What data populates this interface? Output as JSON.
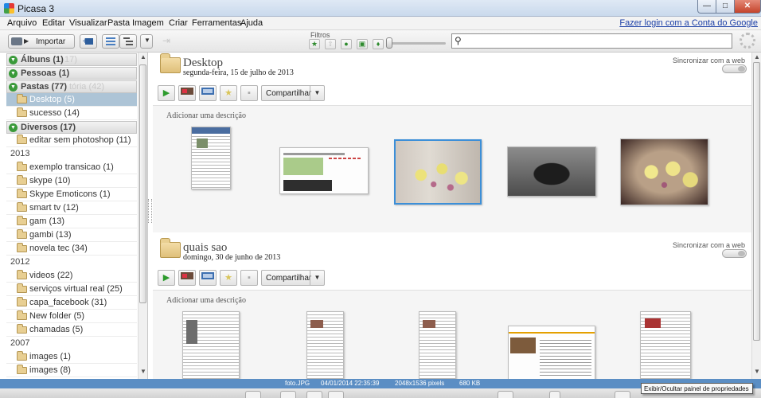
{
  "window": {
    "title": "Picasa 3",
    "controls": {
      "minimize": "—",
      "maximize": "□",
      "close": "✕"
    }
  },
  "menu": {
    "items": [
      "Arquivo",
      "Editar",
      "Visualizar",
      "Pasta",
      "Imagem",
      "Criar",
      "Ferramentas",
      "Ajuda"
    ],
    "login_link": "Fazer login com a Conta do Google"
  },
  "toolbar": {
    "import_label": "Importar",
    "filters_label": "Filtros",
    "search_placeholder": "",
    "search_value": ""
  },
  "sidebar": {
    "groups": {
      "albums": {
        "label": "Álbuns (1)",
        "ghost": "17)"
      },
      "people": {
        "label": "Pessoas (1)"
      },
      "folders": {
        "label": "Pastas (77)",
        "ghost": "tória (42)"
      },
      "various": {
        "label": "Diversos (17)"
      }
    },
    "folders_items": [
      {
        "label": "Desktop (5)",
        "selected": true
      },
      {
        "label": "sucesso (14)"
      }
    ],
    "various_items": [
      {
        "label": "editar sem photoshop (11)"
      }
    ],
    "year_2013": "2013",
    "items_2013": [
      "exemplo transicao (1)",
      "skype (10)",
      "Skype Emoticons (1)",
      "smart tv (12)",
      "gam (13)",
      "gambi (13)",
      "novela tec (34)"
    ],
    "year_2012": "2012",
    "items_2012": [
      "videos (22)",
      "serviços virtual real (25)",
      "capa_facebook (31)",
      "New folder (5)",
      "chamadas (5)"
    ],
    "year_2007": "2007",
    "items_2007": [
      "images (1)",
      "images (8)"
    ]
  },
  "albums": [
    {
      "title": "Desktop",
      "date": "segunda-feira, 15 de julho de 2013",
      "sync_label": "Sincronizar com a web",
      "share_label": "Compartilhar",
      "description_placeholder": "Adicionar uma descrição"
    },
    {
      "title": "quais sao",
      "date": "domingo, 30 de junho de 2013",
      "sync_label": "Sincronizar com a web",
      "share_label": "Compartilhar",
      "description_placeholder": "Adicionar uma descrição"
    }
  ],
  "status": {
    "filename": "foto.JPG",
    "datetime": "04/01/2014 22:35:39",
    "dimensions": "2048x1536 pixels",
    "size": "680 KB"
  },
  "tooltip": "Exibir/Ocultar painel de propriedades",
  "colors": {
    "selection": "#adc4d6",
    "status_bar": "#5b8ec4",
    "link": "#1a3ea6",
    "play_green": "#2d9b2d"
  }
}
